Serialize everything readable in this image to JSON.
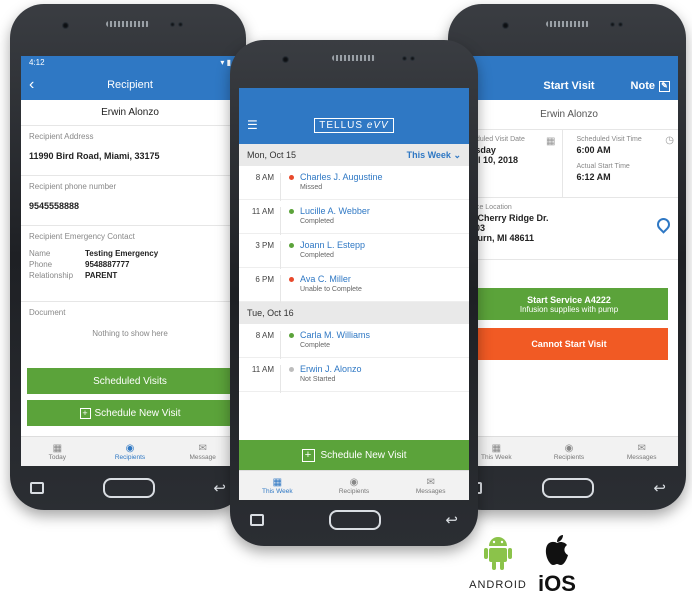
{
  "left_phone": {
    "status_time": "4:12",
    "header_title": "Recipient",
    "recipient_name": "Erwin Alonzo",
    "address_label": "Recipient Address",
    "address_value": "11990 Bird Road, Miami,  33175",
    "phone_label": "Recipient phone number",
    "phone_value": "9545558888",
    "emergency_label": "Recipient Emergency Contact",
    "emergency_name_label": "Name",
    "emergency_name_value": "Testing Emergency",
    "emergency_phone_label": "Phone",
    "emergency_phone_value": "9548887777",
    "emergency_relationship_label": "Relationship",
    "emergency_relationship_value": "PARENT",
    "document_label": "Document",
    "document_empty": "Nothing to show here",
    "scheduled_visits_button": "Scheduled Visits",
    "schedule_new_visit_button": "Schedule New Visit",
    "tabs": [
      "Today",
      "Recipients",
      "Message"
    ]
  },
  "center_phone": {
    "brand_tellus": "TELLUS",
    "brand_evv": "eVV",
    "day1_label": "Mon, Oct 15",
    "week_filter": "This Week",
    "day2_label": "Tue, Oct 16",
    "visits": [
      {
        "time": "8 AM",
        "name": "Charles J. Augustine",
        "status": "Missed",
        "dot": "#e8492b"
      },
      {
        "time": "11 AM",
        "name": "Lucille A. Webber",
        "status": "Completed",
        "dot": "#5ba33a"
      },
      {
        "time": "3 PM",
        "name": "Joann L. Estepp",
        "status": "Completed",
        "dot": "#5ba33a"
      },
      {
        "time": "6 PM",
        "name": "Ava C. Miller",
        "status": "Unable to Complete",
        "dot": "#e8492b"
      },
      {
        "time": "8 AM",
        "name": "Carla M. Williams",
        "status": "Complete",
        "dot": "#5ba33a"
      },
      {
        "time": "11 AM",
        "name": "Erwin J. Alonzo",
        "status": "Not Started",
        "dot": "#bdbdbd"
      }
    ],
    "schedule_new_visit_button": "Schedule New Visit",
    "tabs": [
      "This Week",
      "Recipients",
      "Messages"
    ]
  },
  "right_phone": {
    "header_title": "Start Visit",
    "note_label": "Note",
    "recipient_name": "Erwin Alonzo",
    "scheduled_date_label": "Scheduled Visit Date",
    "scheduled_date_day": "Tuesday",
    "scheduled_date_value": "April 10, 2018",
    "scheduled_time_label": "Scheduled Visit Time",
    "scheduled_time_value": "6:00 AM",
    "actual_start_label": "Actual Start Time",
    "actual_start_value": "6:12 AM",
    "service_location_label": "Service Location",
    "service_location_line1": "247 Cherry Ridge Dr.",
    "service_location_line2": "#6103",
    "service_location_line3": "Auburn, MI 48611",
    "start_service_button": "Start Service A4222",
    "start_service_subtext": "Infusion supplies with pump",
    "cannot_start_button": "Cannot Start Visit",
    "tabs": [
      "This Week",
      "Recipients",
      "Messages"
    ]
  },
  "platforms": {
    "android_label": "ANDROID",
    "ios_label": "iOS"
  },
  "colors": {
    "brand_blue": "#2f78c4",
    "action_green": "#5ba33a",
    "alert_orange": "#f15a24"
  }
}
